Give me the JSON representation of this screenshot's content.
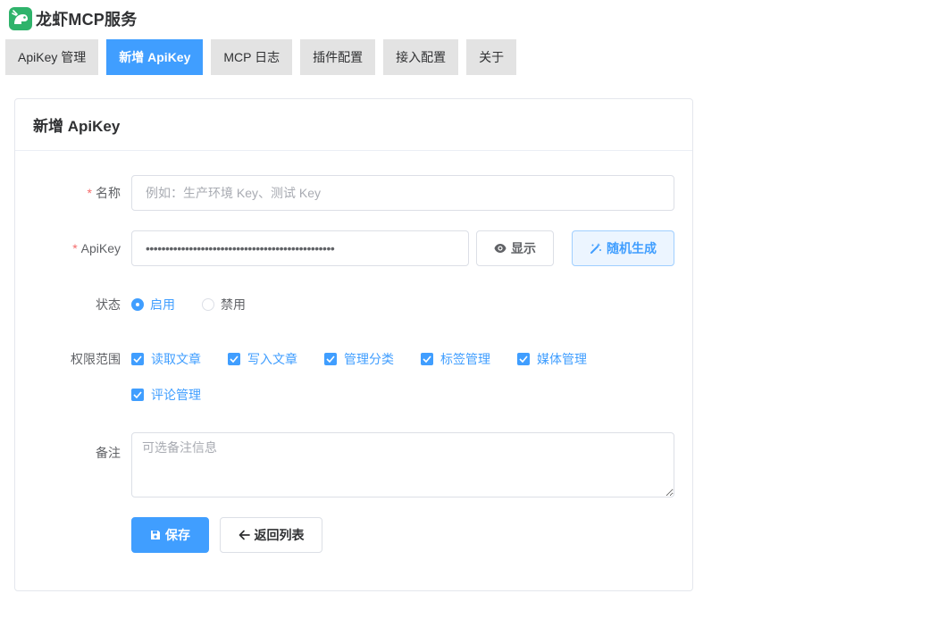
{
  "app": {
    "title": "龙虾MCP服务",
    "logo_icon": "lobster-logo-icon",
    "brand_color": "#2fb36b"
  },
  "tabs": [
    {
      "label": "ApiKey 管理",
      "active": false
    },
    {
      "label": "新增 ApiKey",
      "active": true
    },
    {
      "label": "MCP 日志",
      "active": false
    },
    {
      "label": "插件配置",
      "active": false
    },
    {
      "label": "接入配置",
      "active": false
    },
    {
      "label": "关于",
      "active": false
    }
  ],
  "card": {
    "title": "新增 ApiKey"
  },
  "form": {
    "name": {
      "label": "名称",
      "required_mark": "*",
      "placeholder": "例如：生产环境 Key、测试 Key",
      "value": ""
    },
    "apikey": {
      "label": "ApiKey",
      "required_mark": "*",
      "value": "••••••••••••••••••••••••••••••••••••••••••••••••",
      "show_label": "显示",
      "show_icon": "eye-icon",
      "generate_label": "随机生成",
      "generate_icon": "magic-wand-icon"
    },
    "status": {
      "label": "状态",
      "options": [
        {
          "label": "启用",
          "selected": true
        },
        {
          "label": "禁用",
          "selected": false
        }
      ]
    },
    "scopes": {
      "label": "权限范围",
      "options": [
        {
          "label": "读取文章",
          "checked": true
        },
        {
          "label": "写入文章",
          "checked": true
        },
        {
          "label": "管理分类",
          "checked": true
        },
        {
          "label": "标签管理",
          "checked": true
        },
        {
          "label": "媒体管理",
          "checked": true
        },
        {
          "label": "评论管理",
          "checked": true
        }
      ]
    },
    "remark": {
      "label": "备注",
      "placeholder": "可选备注信息",
      "value": ""
    },
    "actions": {
      "save_label": "保存",
      "save_icon": "save-icon",
      "back_label": "返回列表",
      "back_icon": "arrow-left-icon"
    }
  },
  "colors": {
    "primary": "#409eff",
    "required": "#f56c6c",
    "tab_inactive": "#e3e3e3"
  }
}
